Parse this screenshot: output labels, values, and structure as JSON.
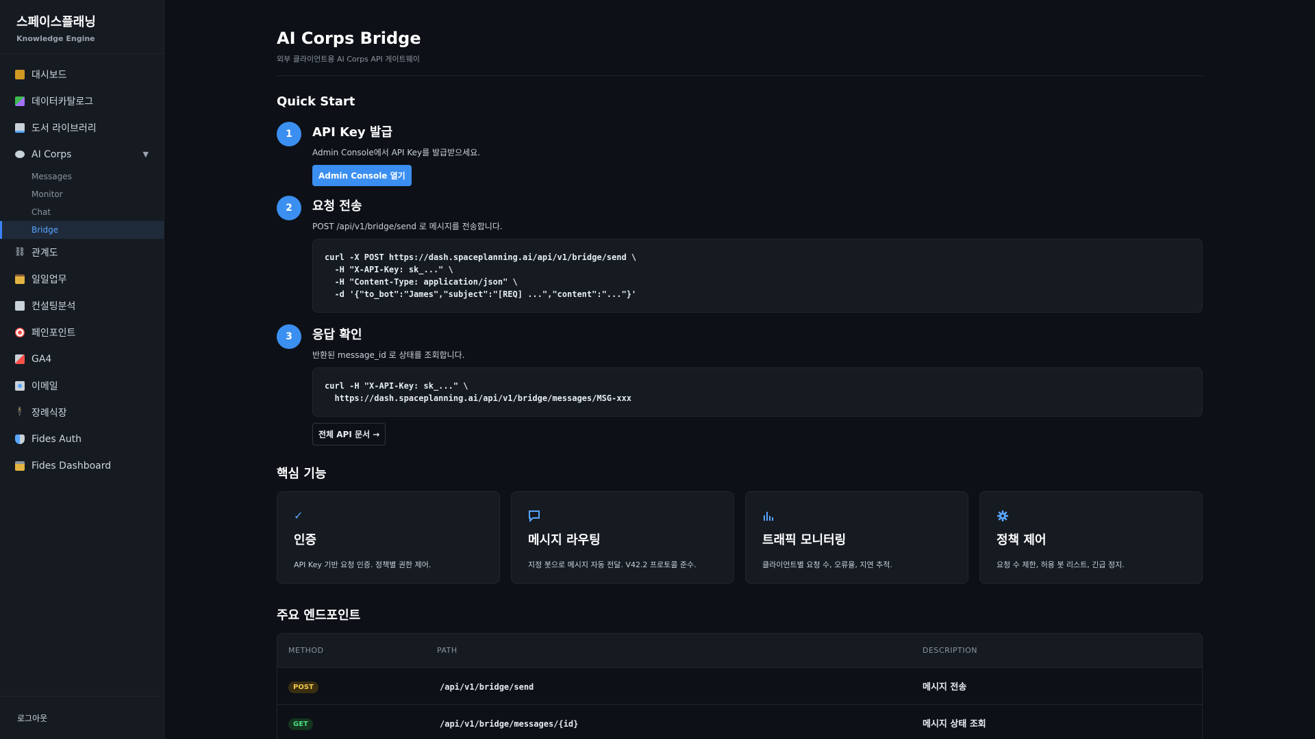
{
  "sidebar": {
    "brand_title": "스페이스플래닝",
    "brand_sub": "Knowledge Engine",
    "items": [
      {
        "label": "대시보드",
        "icon": "chart-icon",
        "color": "#d29922"
      },
      {
        "label": "데이터카탈로그",
        "icon": "catalog-icon",
        "color": "#3fb950"
      },
      {
        "label": "도서 라이브러리",
        "icon": "book-icon",
        "color": "#58a6ff"
      },
      {
        "label": "AI Corps",
        "icon": "speech-bubble-icon",
        "color": "#c9d1d9"
      }
    ],
    "ai_corps_sub": [
      "Messages",
      "Monitor",
      "Chat",
      "Bridge"
    ],
    "items2": [
      {
        "label": "관계도",
        "icon": "link-icon",
        "color": "#c9d1d9"
      },
      {
        "label": "일일업무",
        "icon": "clipboard-icon",
        "color": "#e3b341"
      },
      {
        "label": "컨설팅분석",
        "icon": "trend-chart-icon",
        "color": "#8b949e"
      },
      {
        "label": "페인포인트",
        "icon": "target-icon",
        "color": "#f85149"
      },
      {
        "label": "GA4",
        "icon": "analytics-icon",
        "color": "#f85149"
      },
      {
        "label": "이메일",
        "icon": "email-icon",
        "color": "#58a6ff"
      },
      {
        "label": "장례식장",
        "icon": "person-icon",
        "color": "#e3b341"
      },
      {
        "label": "Fides Auth",
        "icon": "shield-icon",
        "color": "#58a6ff"
      },
      {
        "label": "Fides Dashboard",
        "icon": "lock-icon",
        "color": "#e3b341"
      }
    ],
    "logout": "로그아웃"
  },
  "header": {
    "title": "AI Corps Bridge",
    "subtitle": "외부 클라이언트용 AI Corps API 게이트웨이"
  },
  "quick_start": {
    "title": "Quick Start",
    "steps": [
      {
        "num": "1",
        "title": "API Key 발급",
        "desc": "Admin Console에서 API Key를 발급받으세요.",
        "button": "Admin Console 열기"
      },
      {
        "num": "2",
        "title": "요청 전송",
        "desc": "POST /api/v1/bridge/send 로 메시지를 전송합니다.",
        "code": "curl -X POST https://dash.spaceplanning.ai/api/v1/bridge/send \\\n  -H \"X-API-Key: sk_...\" \\\n  -H \"Content-Type: application/json\" \\\n  -d '{\"to_bot\":\"James\",\"subject\":\"[REQ] ...\",\"content\":\"...\"}'"
      },
      {
        "num": "3",
        "title": "응답 확인",
        "desc": "반환된 message_id 로 상태를 조회합니다.",
        "code": "curl -H \"X-API-Key: sk_...\" \\\n  https://dash.spaceplanning.ai/api/v1/bridge/messages/MSG-xxx"
      }
    ],
    "docs_button": "전체 API 문서 →"
  },
  "features": {
    "title": "핵심 기능",
    "items": [
      {
        "icon": "check-icon",
        "glyph": "✓",
        "title": "인증",
        "desc": "API Key 기반 요청 인증. 정책별 권한 제어."
      },
      {
        "icon": "message-icon",
        "glyph": "▭",
        "title": "메시지 라우팅",
        "desc": "지정 봇으로 메시지 자동 전달. V42.2 프로토콜 준수."
      },
      {
        "icon": "bar-chart-icon",
        "glyph": "▥",
        "title": "트래픽 모니터링",
        "desc": "클라이언트별 요청 수, 오류율, 지연 추적."
      },
      {
        "icon": "gear-icon",
        "glyph": "✹",
        "title": "정책 제어",
        "desc": "요청 수 제한, 허용 봇 리스트, 긴급 정지."
      }
    ]
  },
  "endpoints": {
    "title": "주요 엔드포인트",
    "headers": [
      "METHOD",
      "PATH",
      "DESCRIPTION"
    ],
    "rows": [
      {
        "method": "POST",
        "path": "/api/v1/bridge/send",
        "desc": "메시지 전송"
      },
      {
        "method": "GET",
        "path": "/api/v1/bridge/messages/{id}",
        "desc": "메시지 상태 조회"
      }
    ]
  }
}
